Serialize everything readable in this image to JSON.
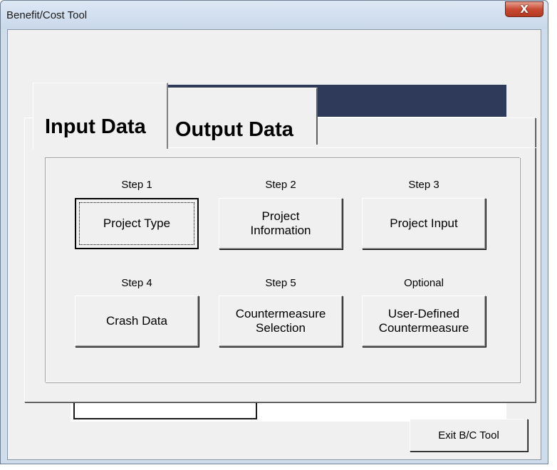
{
  "window": {
    "title": "Benefit/Cost Tool",
    "close_glyph": "X",
    "close_icon": "close-icon"
  },
  "tabs": [
    {
      "label": "Input Data",
      "selected": true
    },
    {
      "label": "Output Data",
      "selected": false
    }
  ],
  "steps": [
    {
      "step": "Step 1",
      "button": "Project Type",
      "focused": true
    },
    {
      "step": "Step 2",
      "button": "Project\nInformation",
      "focused": false
    },
    {
      "step": "Step 3",
      "button": "Project Input",
      "focused": false
    },
    {
      "step": "Step 4",
      "button": "Crash Data",
      "focused": false
    },
    {
      "step": "Step 5",
      "button": "Countermeasure\nSelection",
      "focused": false
    },
    {
      "step": "Optional",
      "button": "User-Defined\nCountermeasure",
      "focused": false
    }
  ],
  "footer": {
    "exit_label": "Exit B/C Tool"
  },
  "colors": {
    "title_bar": "#cfdcec",
    "close_button": "#c74a33",
    "dialog_bg": "#f0f0f0",
    "banner": "#2f3a5a"
  }
}
